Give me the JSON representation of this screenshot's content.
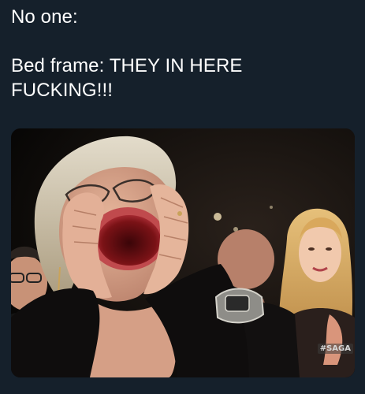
{
  "caption": {
    "line1": "No one:",
    "line2": "Bed frame: THEY IN HERE",
    "line3": "FUCKING!!!"
  },
  "image": {
    "watermark": "#SAGA",
    "background_color": "#15202b"
  }
}
